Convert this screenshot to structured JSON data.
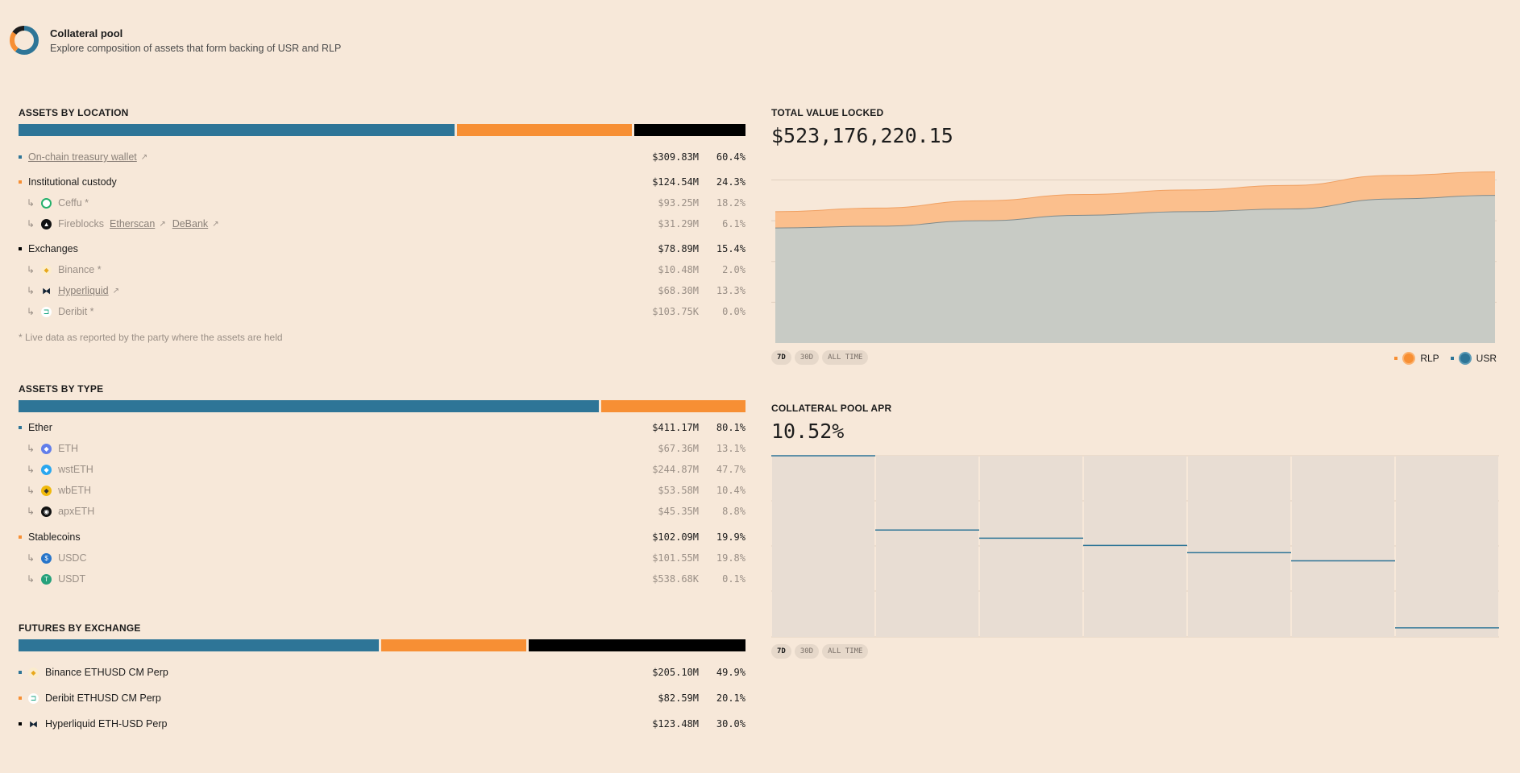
{
  "header": {
    "title": "Collateral pool",
    "subtitle": "Explore composition of assets that form backing of USR and RLP"
  },
  "colors": {
    "blue": "#2e7597",
    "orange": "#f78f34",
    "black": "#000000"
  },
  "location": {
    "title": "ASSETS BY LOCATION",
    "shares": [
      60.4,
      24.3,
      15.4
    ],
    "rows": [
      {
        "label": "On-chain treasury wallet",
        "value": "$309.83M",
        "pct": "60.4%"
      },
      {
        "label": "Institutional custody",
        "value": "$124.54M",
        "pct": "24.3%"
      },
      {
        "label": "Ceffu *",
        "value": "$93.25M",
        "pct": "18.2%"
      },
      {
        "label": "Fireblocks",
        "link1": "Etherscan",
        "link2": "DeBank",
        "value": "$31.29M",
        "pct": "6.1%"
      },
      {
        "label": "Exchanges",
        "value": "$78.89M",
        "pct": "15.4%"
      },
      {
        "label": "Binance *",
        "value": "$10.48M",
        "pct": "2.0%"
      },
      {
        "label": "Hyperliquid",
        "value": "$68.30M",
        "pct": "13.3%"
      },
      {
        "label": "Deribit *",
        "value": "$103.75K",
        "pct": "0.0%"
      }
    ],
    "note": "*  Live data as reported by the party where the assets are held"
  },
  "type": {
    "title": "ASSETS BY TYPE",
    "shares": [
      80.1,
      19.9
    ],
    "rows": [
      {
        "label": "Ether",
        "value": "$411.17M",
        "pct": "80.1%"
      },
      {
        "label": "ETH",
        "value": "$67.36M",
        "pct": "13.1%"
      },
      {
        "label": "wstETH",
        "value": "$244.87M",
        "pct": "47.7%"
      },
      {
        "label": "wbETH",
        "value": "$53.58M",
        "pct": "10.4%"
      },
      {
        "label": "apxETH",
        "value": "$45.35M",
        "pct": "8.8%"
      },
      {
        "label": "Stablecoins",
        "value": "$102.09M",
        "pct": "19.9%"
      },
      {
        "label": "USDC",
        "value": "$101.55M",
        "pct": "19.8%"
      },
      {
        "label": "USDT",
        "value": "$538.68K",
        "pct": "0.1%"
      }
    ]
  },
  "futures": {
    "title": "FUTURES BY EXCHANGE",
    "shares": [
      49.9,
      20.1,
      30.0
    ],
    "rows": [
      {
        "label": "Binance ETHUSD CM Perp",
        "value": "$205.10M",
        "pct": "49.9%"
      },
      {
        "label": "Deribit ETHUSD CM Perp",
        "value": "$82.59M",
        "pct": "20.1%"
      },
      {
        "label": "Hyperliquid ETH-USD Perp",
        "value": "$123.48M",
        "pct": "30.0%"
      }
    ]
  },
  "tvl": {
    "title": "TOTAL VALUE LOCKED",
    "value": "$523,176,220.15",
    "ranges": [
      "7D",
      "30D",
      "ALL TIME"
    ],
    "legend": [
      "RLP",
      "USR"
    ]
  },
  "apr": {
    "title": "COLLATERAL POOL APR",
    "value": "10.52%",
    "ranges": [
      "7D",
      "30D",
      "ALL TIME"
    ]
  },
  "chart_data": [
    {
      "type": "area",
      "title": "TOTAL VALUE LOCKED",
      "stacked": true,
      "x": [
        0,
        1,
        2,
        3,
        4,
        5,
        6,
        7
      ],
      "series": [
        {
          "name": "USR",
          "values": [
            0.635,
            0.645,
            0.675,
            0.705,
            0.725,
            0.74,
            0.795,
            0.815
          ]
        },
        {
          "name": "RLP",
          "values": [
            0.09,
            0.1,
            0.11,
            0.115,
            0.12,
            0.13,
            0.13,
            0.13
          ]
        }
      ],
      "ylim": [
        0,
        1
      ],
      "grid": true
    },
    {
      "type": "line",
      "title": "COLLATERAL POOL APR",
      "step": true,
      "x": [
        1,
        2,
        3,
        4,
        5,
        6,
        7
      ],
      "values": [
        1.0,
        0.59,
        0.545,
        0.505,
        0.465,
        0.42,
        0.05
      ],
      "ylim": [
        0,
        1
      ],
      "grid": true
    }
  ]
}
